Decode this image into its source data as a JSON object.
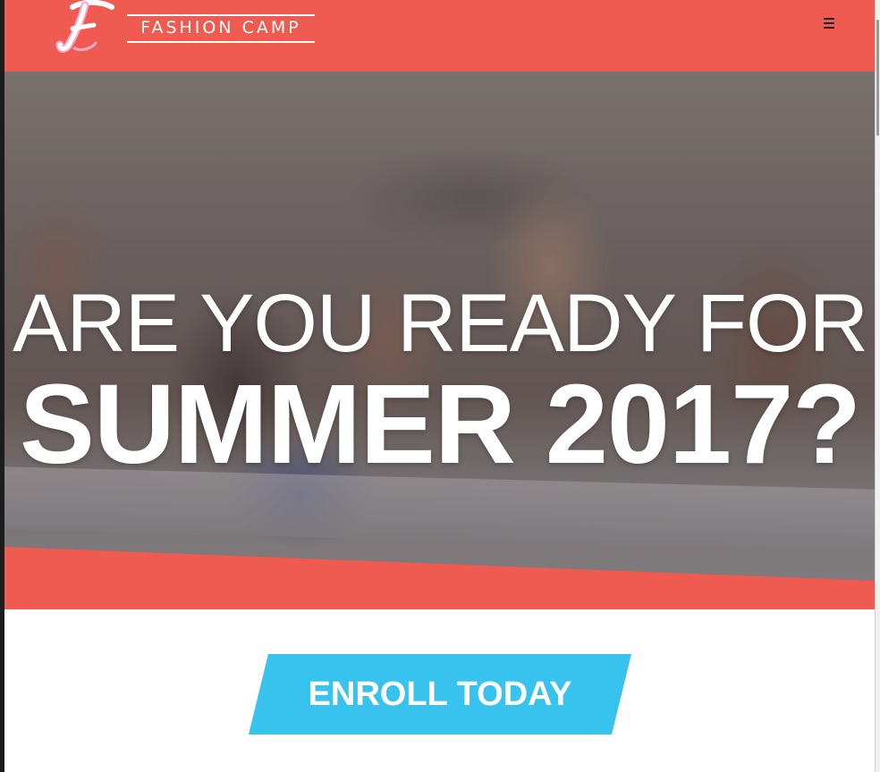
{
  "header": {
    "logo_letter": "F",
    "brand_name": "FASHION CAMP",
    "menu_icon": "hamburger-menu-icon",
    "background_color": "#ef5a51"
  },
  "hero": {
    "title_line_1": "ARE YOU READY FOR",
    "title_line_2": "SUMMER 2017?",
    "band_color": "#ef5a51"
  },
  "cta": {
    "label": "ENROLL TODAY",
    "color": "#38c3ef"
  }
}
